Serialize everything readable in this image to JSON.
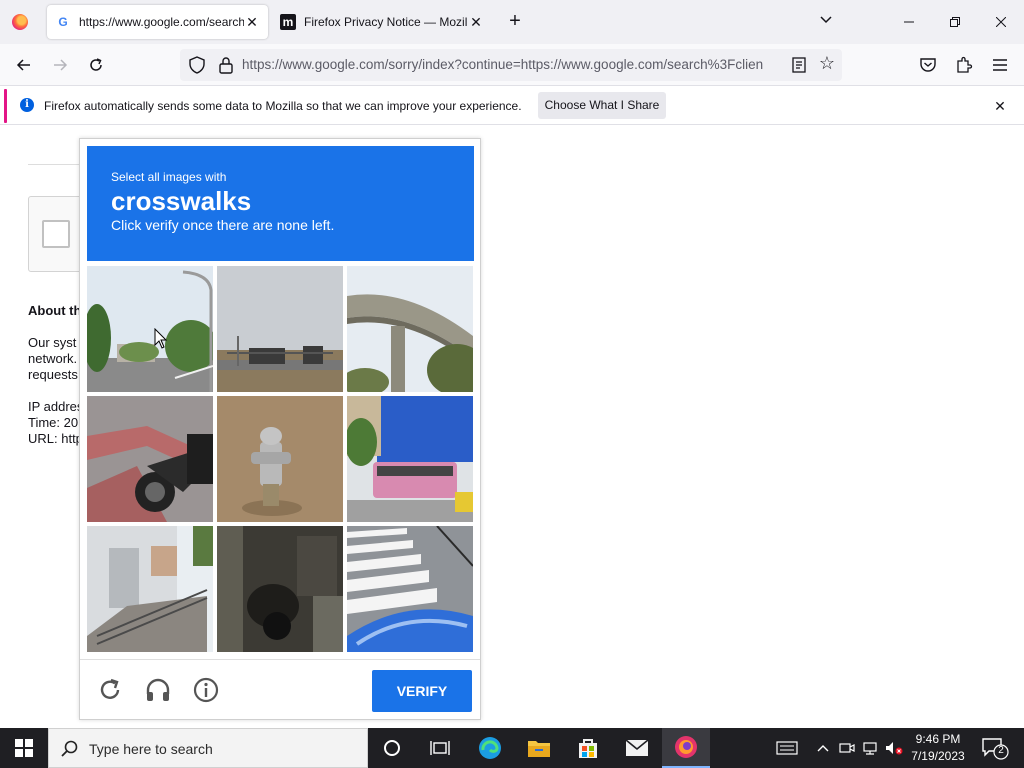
{
  "browser": {
    "tabs": [
      {
        "title": "https://www.google.com/search",
        "favicon": "google-icon",
        "active": true
      },
      {
        "title": "Firefox Privacy Notice — Mozill",
        "favicon": "mozilla-icon",
        "active": false
      }
    ],
    "new_tab": "+",
    "url": "https://www.google.com/sorry/index?continue=https://www.google.com/search%3Fclien"
  },
  "notification": {
    "message": "Firefox automatically sends some data to Mozilla so that we can improve your experience.",
    "button": "Choose What I Share",
    "accent_color": "#e31587"
  },
  "page": {
    "heading": "About th",
    "paragraph_lines": [
      "Our syst",
      "network.",
      "requests"
    ],
    "info_lines": [
      "IP addres",
      "Time: 20",
      "URL: http"
    ]
  },
  "captcha": {
    "prompt": "Select all images with",
    "target": "crosswalks",
    "instruction": "Click verify once there are none left.",
    "header_color": "#1a73e8",
    "tiles": [
      "street-lamp-trees",
      "highway-signs",
      "overpass-bridge",
      "motorcycle-red-pavement",
      "fire-hydrant",
      "pink-bus",
      "building-stairs",
      "dark-motorcycle",
      "crosswalk-stripes"
    ],
    "verify_label": "VERIFY"
  },
  "taskbar": {
    "search_placeholder": "Type here to search",
    "time": "9:46 PM",
    "date": "7/19/2023",
    "notification_count": "2"
  }
}
